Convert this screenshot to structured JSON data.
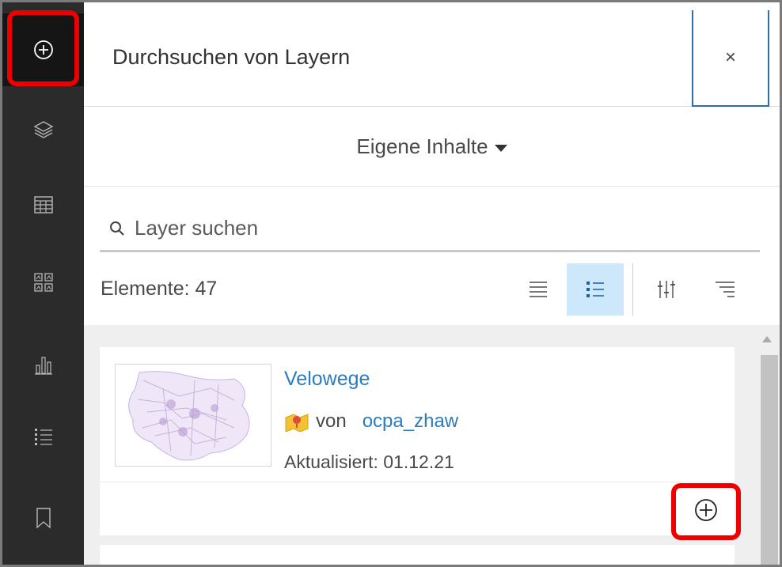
{
  "toolbar": {
    "items": [
      {
        "name": "add-layer",
        "icon": "plus-circle-icon",
        "active": true
      },
      {
        "name": "layers",
        "icon": "layers-icon"
      },
      {
        "name": "table",
        "icon": "table-icon"
      },
      {
        "name": "basemap",
        "icon": "basemap-gallery-icon"
      },
      {
        "name": "charts",
        "icon": "bar-chart-icon"
      },
      {
        "name": "legend",
        "icon": "legend-list-icon"
      },
      {
        "name": "bookmarks",
        "icon": "bookmark-icon"
      }
    ]
  },
  "panel": {
    "title": "Durchsuchen von Layern",
    "close_label": "×",
    "source_label": "Eigene Inhalte"
  },
  "search": {
    "placeholder": "Layer suchen"
  },
  "results": {
    "count_label": "Elemente: 47",
    "views": [
      "list-view-icon",
      "detail-list-view-icon"
    ],
    "tools": [
      "filter-icon",
      "sort-icon"
    ]
  },
  "items": [
    {
      "title": "Velowege",
      "by_label": "von",
      "owner": "ocpa_zhaw",
      "updated": "Aktualisiert: 01.12.21"
    }
  ],
  "colors": {
    "toolbar_bg": "#2b2b2b",
    "accent_blue": "#2b7cc0",
    "highlight_red": "#ee0000",
    "selected_view_bg": "#cde8fa"
  }
}
